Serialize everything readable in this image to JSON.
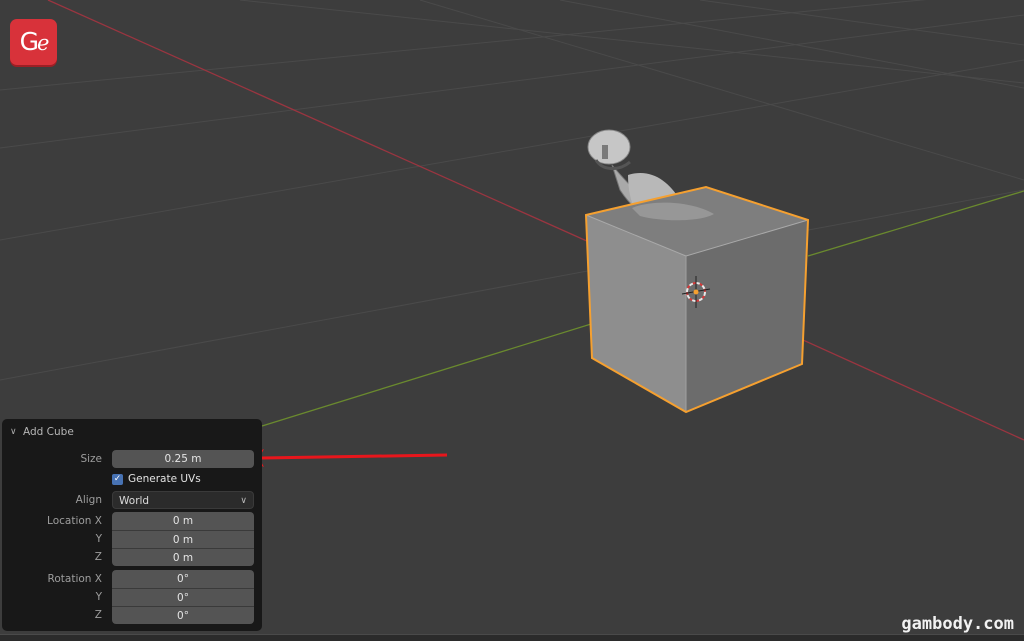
{
  "viewport": {
    "background": "#3d3d3d",
    "grid_color": "#4b4b4b",
    "x_axis_color": "#9a3540",
    "y_axis_color": "#6a8a2e",
    "selection_outline_color": "#f5a030",
    "cube_front_color": "#8e8e8e",
    "cube_right_color": "#6c6c6c",
    "cube_top_color": "#7e7e7e"
  },
  "branding": {
    "logo_text_g": "G",
    "logo_text_e": "e",
    "logo_color": "#d8323a",
    "watermark": "gambody.com"
  },
  "annotation": {
    "arrow_color": "#e8161c",
    "points_to": "size-field"
  },
  "operator_panel": {
    "title": "Add Cube",
    "collapse_icon": "chevron-down-icon",
    "size": {
      "label": "Size",
      "value": "0.25 m"
    },
    "generate_uvs": {
      "label": "Generate UVs",
      "checked": true
    },
    "align": {
      "label": "Align",
      "value": "World"
    },
    "location": [
      {
        "label": "Location X",
        "value": "0 m"
      },
      {
        "label": "Y",
        "value": "0 m"
      },
      {
        "label": "Z",
        "value": "0 m"
      }
    ],
    "rotation": [
      {
        "label": "Rotation X",
        "value": "0°"
      },
      {
        "label": "Y",
        "value": "0°"
      },
      {
        "label": "Z",
        "value": "0°"
      }
    ]
  }
}
